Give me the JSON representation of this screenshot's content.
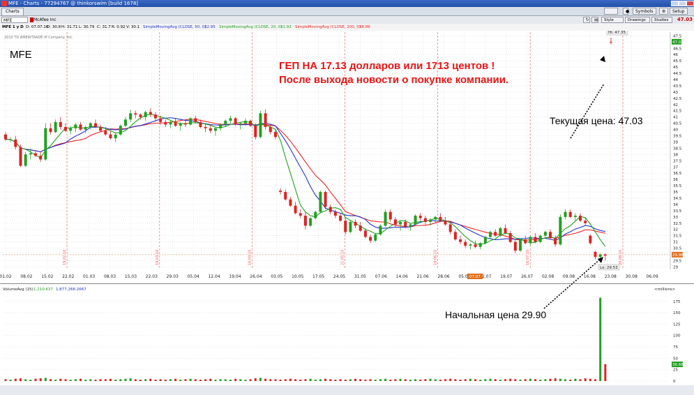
{
  "window": {
    "title": "MFE - Charts - 77294767 @ thinkorswim [build 1678]"
  },
  "tabs": {
    "charts": "Charts"
  },
  "top_buttons": {
    "symbols": "Symbols",
    "setup": "Setup"
  },
  "symbol_bar": {
    "symbol": "MFE",
    "description": "McAfee Inc",
    "style": "Style",
    "drawings": "Drawings",
    "studies": "Studies",
    "last_price": "47.03"
  },
  "study_bar": {
    "aggregation": "MFE 1 y D",
    "date": "D: 07.07.10",
    "open": "O: 30.8",
    "high": "H: 31.71",
    "low": "L: 30.79",
    "close": "C: 31.7",
    "range": "R: 0.92",
    "volume": "V: 30.1",
    "sma50_label": "SimpleMovingAvg (CLOSE, 50, 0)",
    "sma50_value": "32.95",
    "sma20_label": "SimpleMovingAvg (CLOSE, 20, 0)",
    "sma20_value": "31.92",
    "sma200_label": "SimpleMovingAvg (CLOSE, 200, 0)",
    "sma200_value": "38.86"
  },
  "chart": {
    "copyright": "2010 TD AMERITRADE IP Company, Inc.",
    "symbol_watermark": "MFE",
    "hi_label": "Hi: 47.35",
    "lo_label": "Lo: 29.53",
    "current_badge": "47.03",
    "start_badge": "29.98",
    "volume_label": "VolumeAvg (15)",
    "volume_value1": "1,210,637",
    "volume_value2": "1,877,266.2667",
    "millions_label": "<millions>",
    "vol_badge": "36.68",
    "cursor_date": "07.07",
    "colors": {
      "up": "#22a022",
      "down": "#dd2222",
      "sma20": "#22a022",
      "sma50": "#2233cc",
      "sma200": "#ee2222",
      "grid": "#d0d0d0"
    }
  },
  "annotations": {
    "gap_line1": "ГЕП НА 17.13 долларов или 1713 центов !",
    "gap_line2": "После выхода новости о покупке компании.",
    "current_price": "Текущая цена: 47.03",
    "start_price": "Начальная цена 29.90"
  },
  "chart_data": {
    "type": "candlestick",
    "x_ticks": [
      "01.02",
      "08.02",
      "15.02",
      "22.02",
      "01.03",
      "08.03",
      "15.03",
      "22.03",
      "29.03",
      "05.04",
      "12.04",
      "19.04",
      "26.04",
      "03.05",
      "10.05",
      "17.05",
      "24.05",
      "31.05",
      "07.06",
      "14.06",
      "21.06",
      "28.06",
      "05.07",
      "12.07",
      "19.07",
      "26.07",
      "02.08",
      "09.08",
      "16.08",
      "23.08",
      "30.08",
      "06.09"
    ],
    "event_markers": [
      "19.02.10",
      "19.03.10",
      "16.04.10",
      "21.05.10",
      "18.06.10",
      "16.07.10",
      "20.08.10"
    ],
    "y_ticks": [
      29,
      29.5,
      30,
      30.5,
      31,
      31.5,
      32,
      32.5,
      33,
      33.5,
      34,
      34.5,
      35,
      35.5,
      36,
      36.5,
      37,
      37.5,
      38,
      38.5,
      39,
      39.5,
      40,
      40.5,
      41,
      41.5,
      42,
      42.5,
      43,
      43.5,
      44,
      44.5,
      45,
      45.5,
      46,
      46.5,
      47,
      47.5
    ],
    "ylim": [
      28.8,
      47.8
    ],
    "volume_ticks": [
      0,
      25,
      50,
      75,
      100,
      125,
      150,
      175
    ],
    "volume_ylim": [
      0,
      190
    ],
    "candles": [
      [
        39.6,
        39.8,
        39.1,
        39.2
      ],
      [
        39.2,
        39.4,
        39.0,
        39.2
      ],
      [
        39.2,
        39.5,
        38.4,
        38.6
      ],
      [
        38.6,
        38.8,
        37.0,
        37.1
      ],
      [
        37.1,
        38.2,
        37.0,
        38.0
      ],
      [
        38.0,
        38.5,
        37.6,
        38.1
      ],
      [
        38.1,
        38.3,
        37.8,
        37.9
      ],
      [
        37.9,
        38.2,
        37.4,
        37.6
      ],
      [
        37.6,
        40.5,
        37.5,
        40.1
      ],
      [
        40.1,
        40.5,
        39.6,
        39.8
      ],
      [
        39.8,
        40.8,
        39.7,
        40.6
      ],
      [
        40.6,
        41.0,
        40.0,
        40.2
      ],
      [
        40.2,
        40.5,
        39.8,
        39.9
      ],
      [
        39.9,
        40.3,
        39.6,
        40.1
      ],
      [
        40.1,
        40.5,
        39.8,
        40.4
      ],
      [
        40.4,
        40.6,
        39.9,
        40.0
      ],
      [
        40.0,
        40.3,
        39.7,
        40.2
      ],
      [
        40.2,
        40.6,
        40.0,
        40.5
      ],
      [
        40.5,
        40.8,
        40.1,
        40.2
      ],
      [
        40.2,
        40.4,
        39.8,
        39.9
      ],
      [
        39.9,
        40.2,
        39.5,
        39.6
      ],
      [
        39.6,
        39.9,
        39.2,
        39.3
      ],
      [
        39.3,
        39.7,
        39.0,
        39.6
      ],
      [
        39.6,
        40.4,
        39.5,
        40.3
      ],
      [
        40.3,
        41.0,
        40.2,
        40.8
      ],
      [
        40.8,
        41.6,
        40.6,
        41.3
      ],
      [
        41.3,
        41.5,
        40.9,
        41.2
      ],
      [
        41.2,
        41.3,
        40.8,
        41.0
      ],
      [
        41.0,
        41.5,
        40.7,
        41.4
      ],
      [
        41.4,
        41.7,
        41.0,
        41.2
      ],
      [
        41.2,
        41.4,
        40.7,
        40.9
      ],
      [
        40.9,
        41.1,
        40.4,
        40.6
      ],
      [
        40.6,
        40.8,
        40.2,
        40.4
      ],
      [
        40.4,
        40.7,
        40.1,
        40.6
      ],
      [
        40.6,
        40.9,
        40.2,
        40.3
      ],
      [
        40.3,
        40.6,
        39.9,
        40.5
      ],
      [
        40.5,
        40.8,
        40.2,
        40.4
      ],
      [
        40.4,
        41.0,
        40.3,
        40.9
      ],
      [
        40.9,
        41.1,
        40.5,
        40.6
      ],
      [
        40.6,
        40.8,
        40.1,
        40.2
      ],
      [
        40.2,
        40.5,
        39.8,
        40.1
      ],
      [
        40.1,
        40.4,
        39.7,
        39.9
      ],
      [
        39.9,
        40.2,
        39.5,
        40.1
      ],
      [
        40.1,
        40.5,
        39.9,
        40.4
      ],
      [
        40.4,
        40.8,
        40.2,
        40.7
      ],
      [
        40.7,
        41.1,
        40.5,
        40.9
      ],
      [
        40.9,
        41.0,
        40.3,
        40.4
      ],
      [
        40.4,
        40.6,
        40.0,
        40.5
      ],
      [
        40.5,
        40.9,
        40.3,
        40.7
      ],
      [
        40.7,
        40.8,
        40.2,
        40.3
      ],
      [
        40.3,
        40.5,
        39.2,
        39.4
      ],
      [
        39.4,
        41.5,
        39.3,
        41.3
      ],
      [
        41.3,
        41.6,
        40.0,
        40.2
      ],
      [
        40.2,
        40.4,
        39.6,
        39.8
      ],
      [
        39.8,
        40.0,
        39.2,
        39.4
      ],
      [
        35.1,
        35.3,
        34.8,
        35.0
      ],
      [
        35.0,
        35.2,
        34.3,
        34.4
      ],
      [
        34.4,
        34.6,
        33.8,
        33.9
      ],
      [
        33.9,
        34.2,
        33.2,
        33.3
      ],
      [
        33.3,
        33.6,
        32.9,
        33.1
      ],
      [
        33.1,
        33.4,
        32.0,
        32.3
      ],
      [
        32.3,
        33.0,
        32.2,
        32.9
      ],
      [
        32.9,
        33.5,
        32.8,
        33.4
      ],
      [
        33.4,
        35.1,
        33.3,
        35.0
      ],
      [
        35.0,
        35.1,
        33.6,
        33.8
      ],
      [
        33.8,
        34.0,
        33.2,
        33.4
      ],
      [
        33.4,
        33.6,
        32.9,
        33.1
      ],
      [
        33.1,
        33.3,
        32.6,
        32.7
      ],
      [
        32.7,
        32.9,
        31.6,
        31.8
      ],
      [
        31.8,
        32.7,
        31.7,
        32.6
      ],
      [
        32.6,
        32.8,
        32.1,
        32.3
      ],
      [
        32.3,
        32.6,
        31.8,
        31.9
      ],
      [
        31.9,
        32.1,
        31.3,
        31.4
      ],
      [
        31.4,
        31.6,
        30.9,
        31.1
      ],
      [
        31.1,
        31.7,
        31.0,
        31.6
      ],
      [
        31.6,
        32.4,
        31.5,
        32.3
      ],
      [
        32.3,
        33.6,
        32.2,
        33.4
      ],
      [
        33.4,
        33.6,
        32.6,
        32.8
      ],
      [
        32.8,
        33.0,
        32.2,
        32.4
      ],
      [
        32.4,
        32.7,
        31.9,
        32.6
      ],
      [
        32.6,
        32.8,
        32.1,
        32.2
      ],
      [
        32.2,
        32.5,
        31.9,
        32.4
      ],
      [
        32.4,
        33.2,
        32.3,
        33.1
      ],
      [
        33.1,
        33.3,
        32.7,
        32.9
      ],
      [
        32.9,
        33.1,
        32.4,
        32.6
      ],
      [
        32.6,
        32.9,
        32.3,
        32.8
      ],
      [
        32.8,
        33.1,
        32.5,
        33.0
      ],
      [
        33.0,
        33.3,
        32.6,
        32.7
      ],
      [
        32.7,
        33.0,
        32.3,
        32.4
      ],
      [
        32.4,
        32.6,
        31.6,
        31.8
      ],
      [
        31.8,
        32.0,
        31.1,
        31.2
      ],
      [
        31.2,
        31.5,
        30.8,
        31.0
      ],
      [
        31.0,
        31.2,
        30.5,
        30.7
      ],
      [
        30.7,
        30.9,
        30.4,
        30.8
      ],
      [
        30.8,
        31.1,
        30.5,
        30.6
      ],
      [
        30.6,
        31.0,
        30.4,
        30.9
      ],
      [
        30.9,
        31.5,
        30.8,
        31.4
      ],
      [
        31.4,
        31.9,
        31.2,
        31.8
      ],
      [
        31.8,
        32.0,
        31.4,
        31.5
      ],
      [
        31.5,
        32.2,
        31.4,
        32.1
      ],
      [
        32.1,
        32.4,
        31.6,
        31.7
      ],
      [
        31.7,
        31.9,
        30.9,
        31.0
      ],
      [
        31.0,
        31.2,
        30.1,
        30.3
      ],
      [
        30.3,
        31.3,
        30.2,
        31.2
      ],
      [
        31.2,
        31.5,
        30.8,
        30.9
      ],
      [
        30.9,
        31.5,
        30.7,
        31.4
      ],
      [
        31.4,
        31.7,
        30.9,
        31.0
      ],
      [
        31.0,
        31.6,
        30.9,
        31.5
      ],
      [
        31.5,
        31.9,
        31.3,
        31.8
      ],
      [
        31.8,
        32.0,
        31.2,
        31.3
      ],
      [
        31.3,
        31.5,
        30.6,
        30.8
      ],
      [
        30.8,
        33.2,
        30.7,
        33.0
      ],
      [
        33.0,
        33.6,
        32.8,
        33.4
      ],
      [
        33.4,
        33.6,
        32.9,
        33.0
      ],
      [
        33.0,
        33.3,
        32.7,
        33.1
      ],
      [
        33.1,
        33.3,
        32.6,
        32.7
      ],
      [
        32.7,
        32.9,
        32.3,
        32.5
      ],
      [
        31.5,
        31.6,
        30.8,
        30.9
      ],
      [
        30.2,
        30.3,
        29.6,
        29.8
      ],
      [
        29.8,
        30.1,
        29.6,
        30.0
      ],
      [
        30.0,
        30.1,
        29.5,
        29.9
      ],
      [
        47.03,
        47.35,
        46.8,
        47.0
      ]
    ],
    "volumes_millions": [
      4,
      3,
      5,
      6,
      4,
      3,
      5,
      6,
      7,
      4,
      3,
      5,
      4,
      3,
      4,
      5,
      3,
      4,
      3,
      4,
      4,
      5,
      3,
      4,
      5,
      6,
      4,
      3,
      4,
      5,
      3,
      4,
      3,
      4,
      5,
      3,
      4,
      5,
      4,
      3,
      4,
      5,
      3,
      4,
      4,
      3,
      5,
      4,
      3,
      4,
      6,
      7,
      5,
      4,
      4,
      3,
      4,
      5,
      4,
      3,
      4,
      5,
      3,
      4,
      5,
      4,
      3,
      4,
      3,
      4,
      5,
      4,
      3,
      4,
      3,
      4,
      5,
      3,
      4,
      5,
      4,
      3,
      4,
      3,
      4,
      5,
      4,
      3,
      4,
      5,
      4,
      3,
      4,
      5,
      4,
      3,
      4,
      5,
      4,
      3,
      4,
      5,
      4,
      3,
      4,
      5,
      4,
      3,
      4,
      5,
      6,
      5,
      4,
      3,
      5,
      4,
      6,
      5,
      4,
      183,
      37
    ]
  }
}
